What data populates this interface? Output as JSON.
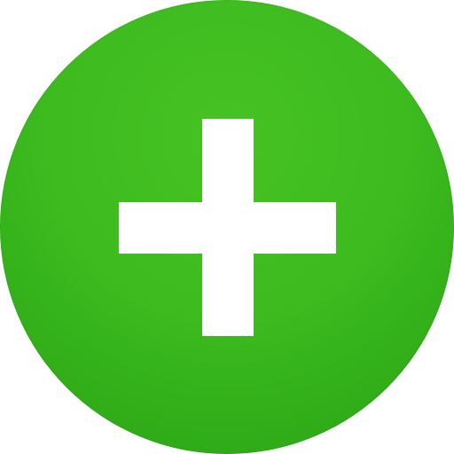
{
  "icon": {
    "name": "add-icon",
    "symbol": "plus-icon",
    "colors": {
      "circle_fill": "#3dbb1f",
      "circle_fill_light": "#47c224",
      "circle_fill_dark": "#27a313",
      "symbol_fill": "#ffffff"
    }
  }
}
